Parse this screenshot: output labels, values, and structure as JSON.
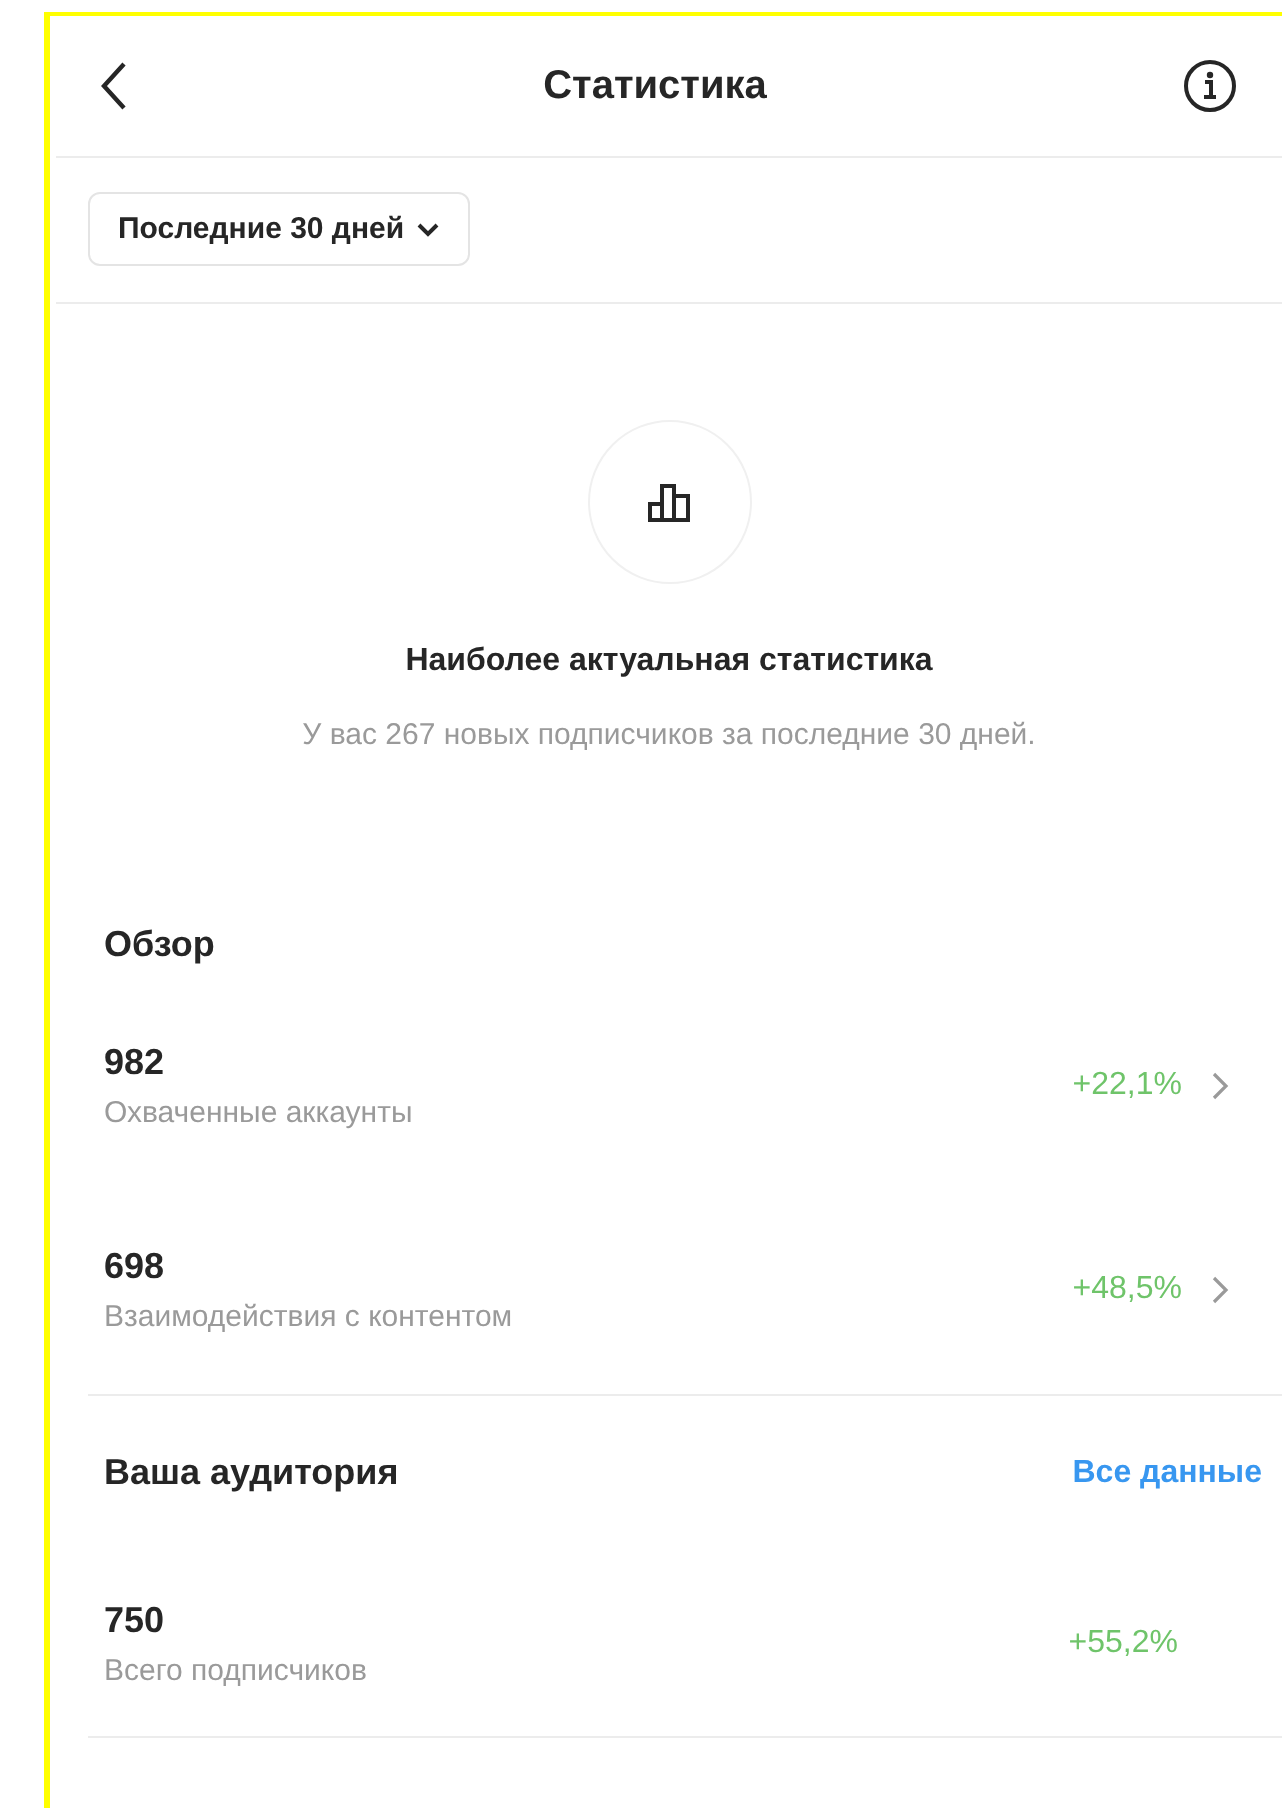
{
  "header": {
    "title": "Статистика"
  },
  "period": {
    "label": "Последние 30 дней"
  },
  "highlight": {
    "title": "Наиболее актуальная статистика",
    "text": "У вас 267 новых подписчиков за последние 30 дней."
  },
  "overview": {
    "title": "Обзор",
    "metrics": [
      {
        "value": "982",
        "label": "Охваченные аккаунты",
        "change": "+22,1%",
        "chevron": true
      },
      {
        "value": "698",
        "label": "Взаимодействия с контентом",
        "change": "+48,5%",
        "chevron": true
      }
    ]
  },
  "audience": {
    "title": "Ваша аудитория",
    "link": "Все данные",
    "metrics": [
      {
        "value": "750",
        "label": "Всего подписчиков",
        "change": "+55,2%",
        "chevron": false
      }
    ]
  }
}
